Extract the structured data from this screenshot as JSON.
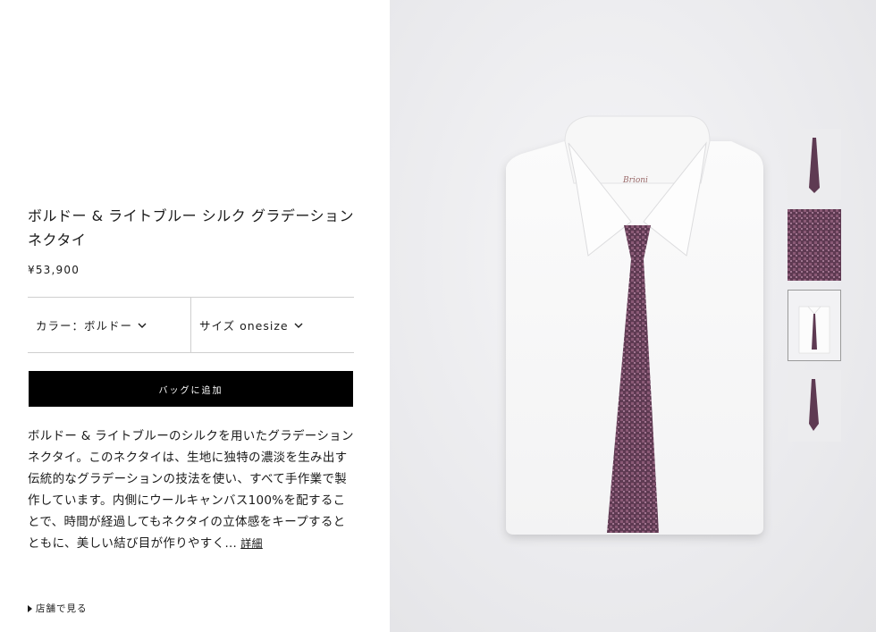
{
  "product": {
    "title": "ボルドー & ライトブルー シルク グラデーション ネクタイ",
    "price": "¥53,900"
  },
  "selectors": {
    "color_label": "カラー：ボルドー",
    "size_label": "サイズ onesize"
  },
  "actions": {
    "add_to_bag": "バッグに追加",
    "store_link": "店舗で見る"
  },
  "description": {
    "text": "ボルドー & ライトブルーのシルクを用いたグラデーション ネクタイ。このネクタイは、生地に独特の濃淡を生み出す伝統的なグラデーションの技法を使い、すべて手作業で製作しています。内側にウールキャンバス100%を配することで、時間が経過してもネクタイの立体感をキープするとともに、美しい結び目が作りやすく…",
    "more_link": "詳細"
  },
  "image": {
    "collar_brand": "Brioni"
  },
  "thumbnails": [
    "tie-full-view",
    "tie-fabric-closeup",
    "tie-with-shirt",
    "tie-side-view"
  ],
  "selected_thumbnail": 3,
  "colors": {
    "tie": "#6a4159",
    "button_bg": "#000000",
    "panel_bg": "#e9e9ec"
  }
}
